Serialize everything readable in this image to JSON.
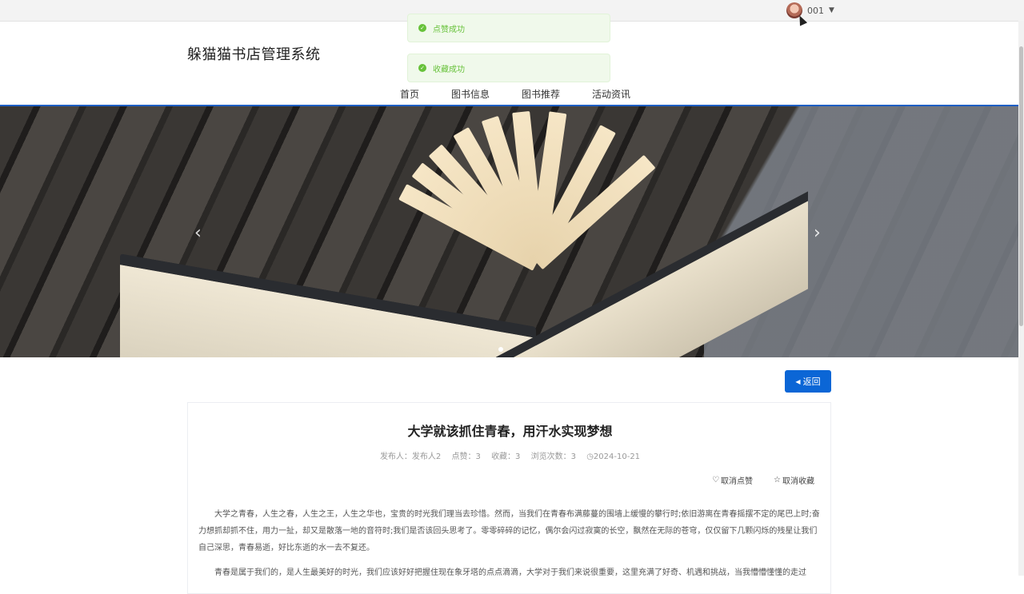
{
  "header": {
    "site_title": "躲猫猫书店管理系统",
    "user_name": "001",
    "nav": [
      "首页",
      "图书信息",
      "图书推荐",
      "活动资讯"
    ]
  },
  "toasts": [
    "点赞成功",
    "收藏成功"
  ],
  "banner": {
    "prev": "‹",
    "next": "›"
  },
  "back_label": "返回",
  "article": {
    "title": "大学就该抓住青春，用汗水实现梦想",
    "publisher": "发布人：发布人2",
    "likes": "点赞：3",
    "favorites": "收藏：3",
    "views": "浏览次数：3",
    "date": "2024-10-21",
    "cancel_like": "取消点赞",
    "cancel_fav": "取消收藏",
    "paragraphs": [
      "大学之青春，人生之春，人生之王，人生之华也，宝贵的时光我们理当去珍惜。然而，当我们在青春布满藤蔓的围墙上缓慢的攀行时;依旧游离在青春摇摆不定的尾巴上时;奋力想抓却抓不住，用力一扯，却又是散落一地的音符时;我们是否该回头思考了。零零碎碎的记忆，偶尔会闪过寂寞的长空，飘然在无际的苍穹，仅仅留下几颗闪烁的残星让我们自己深思，青春易逝，好比东逝的水一去不复还。",
      "青春是属于我们的，是人生最美好的时光，我们应该好好把握住现在象牙塔的点点滴滴，大学对于我们来说很重要，这里充满了好奇、机遇和挑战，当我懵懵懂懂的走过"
    ]
  }
}
